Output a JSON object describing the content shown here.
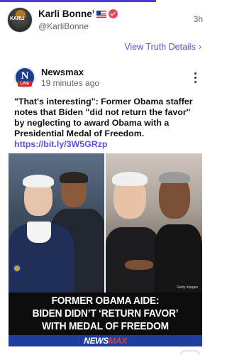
{
  "post": {
    "author": {
      "display_name": "Karli Bonne’",
      "handle": "@KarliBonne",
      "avatar_text": "KARLI",
      "flag_icon": "us-flag-icon",
      "verified_icon": "verified-badge-icon",
      "verified_color": "#e94560"
    },
    "time": "3h",
    "view_link": {
      "label": "View Truth Details",
      "chevron": "›"
    }
  },
  "shared": {
    "source": {
      "name": "Newsmax",
      "time": "19 minutes ago",
      "logo_letter": "N",
      "logo_badge": "LIVE",
      "logo_color": "#1b3c8f"
    },
    "text": "\"That's interesting\": Former Obama staffer notes that Biden \"did not return the favor\" by neglecting to award Obama with a Presidential Medal of Freedom.",
    "link": "https://bit.ly/3W5GRzp",
    "media": {
      "caption_lines": [
        "FORMER OBAMA AIDE:",
        "BIDEN DIDN’T ‘RETURN FAVOR’",
        "WITH MEDAL OF FREEDOM"
      ],
      "brand": {
        "prefix": "NEWS",
        "suffix": "MAX"
      },
      "credit": "Getty Images"
    }
  },
  "colors": {
    "accent": "#5b52d6",
    "brand_blue": "#1f3f9c"
  }
}
